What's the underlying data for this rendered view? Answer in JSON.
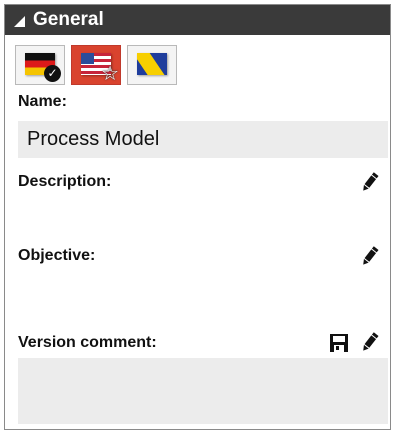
{
  "panel": {
    "title": "General"
  },
  "languages": [
    {
      "name": "German",
      "icon": "german-flag-icon",
      "status": "checked"
    },
    {
      "name": "English (US)",
      "icon": "us-flag-icon",
      "status": "active"
    },
    {
      "name": "Bosnian",
      "icon": "bosnia-flag-icon",
      "status": ""
    }
  ],
  "fields": {
    "name": {
      "label": "Name:",
      "value": "Process Model"
    },
    "description": {
      "label": "Description:",
      "value": ""
    },
    "objective": {
      "label": "Objective:",
      "value": ""
    },
    "version_comment": {
      "label": "Version comment:",
      "value": ""
    }
  },
  "icons": {
    "edit": "pencil-icon",
    "save": "save-icon",
    "check": "checkmark-icon",
    "star": "star-icon"
  },
  "colors": {
    "header_bg": "#3a3a3a",
    "active_flag_bg": "#d9432e",
    "field_bg": "#ececec"
  }
}
